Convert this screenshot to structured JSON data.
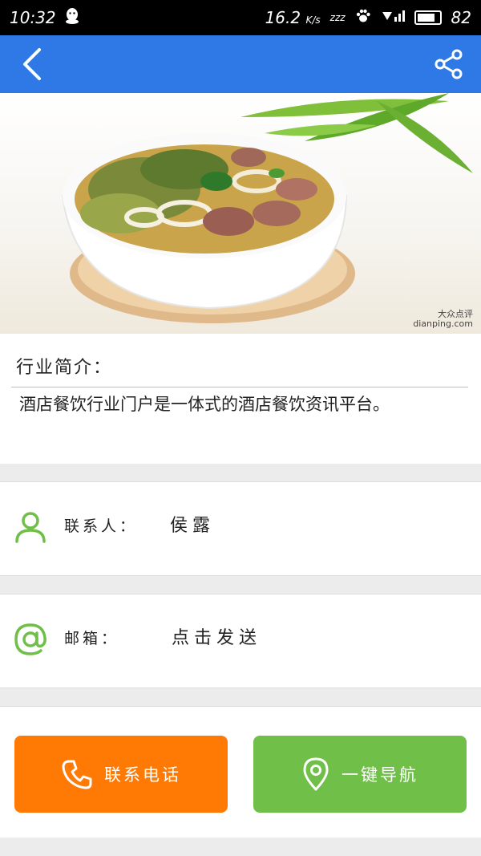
{
  "status_bar": {
    "time": "10:32",
    "network_speed": "16.2",
    "network_unit": "K/s",
    "sleep_glyph": "zzz",
    "battery_level": "82",
    "battery_fraction": 0.82,
    "icons": [
      "qq-icon",
      "paw-icon",
      "signal-icon"
    ]
  },
  "title_bar": {
    "back_icon": "chevron-left-icon",
    "share_icon": "share-icon",
    "color": "#2e79e6"
  },
  "hero": {
    "watermark_line1": "大众点评",
    "watermark_line2": "dianping.com"
  },
  "intro": {
    "heading": "行业简介：",
    "text": "酒店餐饮行业门户是一体式的酒店餐饮资讯平台。"
  },
  "contact": {
    "label": "联系人：",
    "value": "侯露",
    "icon": "person-icon",
    "icon_color": "#6fbf49"
  },
  "email": {
    "label": "邮箱：",
    "value": "点击发送",
    "icon": "at-icon",
    "icon_color": "#6fbf49"
  },
  "actions": {
    "call_label": "联系电话",
    "call_icon": "phone-icon",
    "call_color": "#ff7a05",
    "nav_label": "一键导航",
    "nav_icon": "location-pin-icon",
    "nav_color": "#6fbf49"
  }
}
